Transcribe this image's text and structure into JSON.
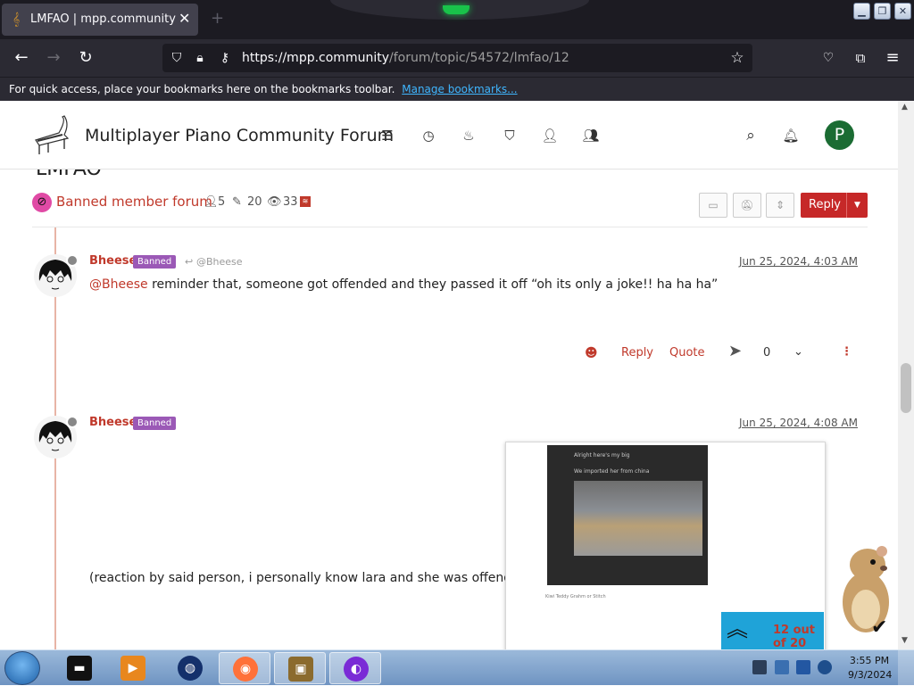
{
  "browser": {
    "tab_title": "LMFAO | mpp.community",
    "url_host": "https://mpp.community",
    "url_path": "/forum/topic/54572/lmfao/12",
    "bookmarks_message": "For quick access, place your bookmarks here on the bookmarks toolbar.",
    "bookmarks_link": "Manage bookmarks..."
  },
  "forum": {
    "site_name": "Multiplayer Piano Community Forum",
    "nav_icons": [
      "categories-icon",
      "recent-icon",
      "popular-icon",
      "tags-icon",
      "users-icon",
      "groups-icon"
    ],
    "user_initial": "P",
    "avatar_color": "#1b6c33"
  },
  "topic": {
    "title": "LMFAO",
    "category": "Banned member forum",
    "posters": "5",
    "posts": "20",
    "views": "33",
    "reply_label": "Reply"
  },
  "posts": [
    {
      "username": "Bheese",
      "badge": "Banned",
      "reply_to": "@Bheese",
      "time": "Jun 25, 2024, 4:03 AM",
      "mention": "@Bheese",
      "text": " reminder that, someone got offended and they passed it off “oh its only a joke!! ha ha ha”",
      "actions": {
        "reply": "Reply",
        "quote": "Quote",
        "votes": "0"
      }
    },
    {
      "username": "Bheese",
      "badge": "Banned",
      "time": "Jun 25, 2024, 4:08 AM",
      "text": "(reaction by said person, i personally know lara and she was offended)",
      "embed": {
        "line1": "Alright here's my big",
        "line2": "We imported her from china",
        "caption": "Kiwi Teddy Grahm or Stitch"
      }
    }
  ],
  "pagination": {
    "text": "12 out of 20"
  },
  "colors": {
    "accent": "#c0392b",
    "banned_badge": "#9b59b6",
    "progress": "#1fa3d8"
  },
  "taskbar": {
    "time": "3:55 PM",
    "date": "9/3/2024",
    "apps": [
      "files-icon",
      "media-player-icon",
      "globe-icon",
      "firefox-icon",
      "game-box-icon",
      "mask-app-icon"
    ]
  }
}
